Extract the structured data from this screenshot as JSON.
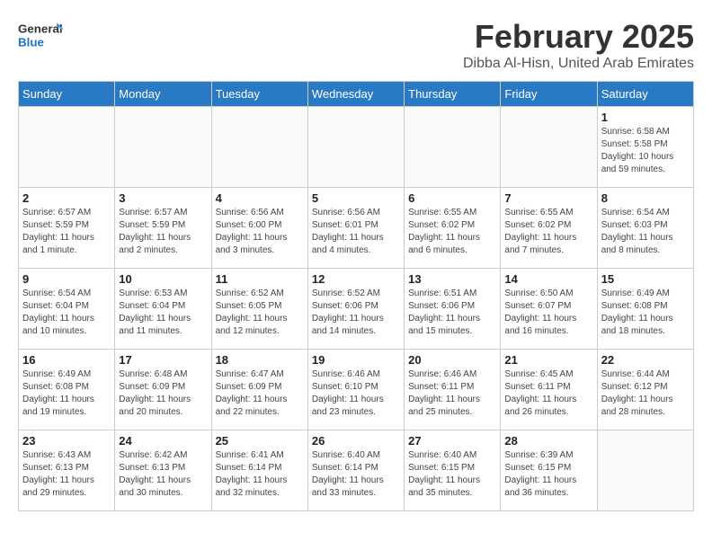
{
  "logo": {
    "general": "General",
    "blue": "Blue"
  },
  "header": {
    "title": "February 2025",
    "subtitle": "Dibba Al-Hisn, United Arab Emirates"
  },
  "weekdays": [
    "Sunday",
    "Monday",
    "Tuesday",
    "Wednesday",
    "Thursday",
    "Friday",
    "Saturday"
  ],
  "weeks": [
    [
      {
        "day": "",
        "info": ""
      },
      {
        "day": "",
        "info": ""
      },
      {
        "day": "",
        "info": ""
      },
      {
        "day": "",
        "info": ""
      },
      {
        "day": "",
        "info": ""
      },
      {
        "day": "",
        "info": ""
      },
      {
        "day": "1",
        "info": "Sunrise: 6:58 AM\nSunset: 5:58 PM\nDaylight: 10 hours and 59 minutes."
      }
    ],
    [
      {
        "day": "2",
        "info": "Sunrise: 6:57 AM\nSunset: 5:59 PM\nDaylight: 11 hours and 1 minute."
      },
      {
        "day": "3",
        "info": "Sunrise: 6:57 AM\nSunset: 5:59 PM\nDaylight: 11 hours and 2 minutes."
      },
      {
        "day": "4",
        "info": "Sunrise: 6:56 AM\nSunset: 6:00 PM\nDaylight: 11 hours and 3 minutes."
      },
      {
        "day": "5",
        "info": "Sunrise: 6:56 AM\nSunset: 6:01 PM\nDaylight: 11 hours and 4 minutes."
      },
      {
        "day": "6",
        "info": "Sunrise: 6:55 AM\nSunset: 6:02 PM\nDaylight: 11 hours and 6 minutes."
      },
      {
        "day": "7",
        "info": "Sunrise: 6:55 AM\nSunset: 6:02 PM\nDaylight: 11 hours and 7 minutes."
      },
      {
        "day": "8",
        "info": "Sunrise: 6:54 AM\nSunset: 6:03 PM\nDaylight: 11 hours and 8 minutes."
      }
    ],
    [
      {
        "day": "9",
        "info": "Sunrise: 6:54 AM\nSunset: 6:04 PM\nDaylight: 11 hours and 10 minutes."
      },
      {
        "day": "10",
        "info": "Sunrise: 6:53 AM\nSunset: 6:04 PM\nDaylight: 11 hours and 11 minutes."
      },
      {
        "day": "11",
        "info": "Sunrise: 6:52 AM\nSunset: 6:05 PM\nDaylight: 11 hours and 12 minutes."
      },
      {
        "day": "12",
        "info": "Sunrise: 6:52 AM\nSunset: 6:06 PM\nDaylight: 11 hours and 14 minutes."
      },
      {
        "day": "13",
        "info": "Sunrise: 6:51 AM\nSunset: 6:06 PM\nDaylight: 11 hours and 15 minutes."
      },
      {
        "day": "14",
        "info": "Sunrise: 6:50 AM\nSunset: 6:07 PM\nDaylight: 11 hours and 16 minutes."
      },
      {
        "day": "15",
        "info": "Sunrise: 6:49 AM\nSunset: 6:08 PM\nDaylight: 11 hours and 18 minutes."
      }
    ],
    [
      {
        "day": "16",
        "info": "Sunrise: 6:49 AM\nSunset: 6:08 PM\nDaylight: 11 hours and 19 minutes."
      },
      {
        "day": "17",
        "info": "Sunrise: 6:48 AM\nSunset: 6:09 PM\nDaylight: 11 hours and 20 minutes."
      },
      {
        "day": "18",
        "info": "Sunrise: 6:47 AM\nSunset: 6:09 PM\nDaylight: 11 hours and 22 minutes."
      },
      {
        "day": "19",
        "info": "Sunrise: 6:46 AM\nSunset: 6:10 PM\nDaylight: 11 hours and 23 minutes."
      },
      {
        "day": "20",
        "info": "Sunrise: 6:46 AM\nSunset: 6:11 PM\nDaylight: 11 hours and 25 minutes."
      },
      {
        "day": "21",
        "info": "Sunrise: 6:45 AM\nSunset: 6:11 PM\nDaylight: 11 hours and 26 minutes."
      },
      {
        "day": "22",
        "info": "Sunrise: 6:44 AM\nSunset: 6:12 PM\nDaylight: 11 hours and 28 minutes."
      }
    ],
    [
      {
        "day": "23",
        "info": "Sunrise: 6:43 AM\nSunset: 6:13 PM\nDaylight: 11 hours and 29 minutes."
      },
      {
        "day": "24",
        "info": "Sunrise: 6:42 AM\nSunset: 6:13 PM\nDaylight: 11 hours and 30 minutes."
      },
      {
        "day": "25",
        "info": "Sunrise: 6:41 AM\nSunset: 6:14 PM\nDaylight: 11 hours and 32 minutes."
      },
      {
        "day": "26",
        "info": "Sunrise: 6:40 AM\nSunset: 6:14 PM\nDaylight: 11 hours and 33 minutes."
      },
      {
        "day": "27",
        "info": "Sunrise: 6:40 AM\nSunset: 6:15 PM\nDaylight: 11 hours and 35 minutes."
      },
      {
        "day": "28",
        "info": "Sunrise: 6:39 AM\nSunset: 6:15 PM\nDaylight: 11 hours and 36 minutes."
      },
      {
        "day": "",
        "info": ""
      }
    ]
  ]
}
